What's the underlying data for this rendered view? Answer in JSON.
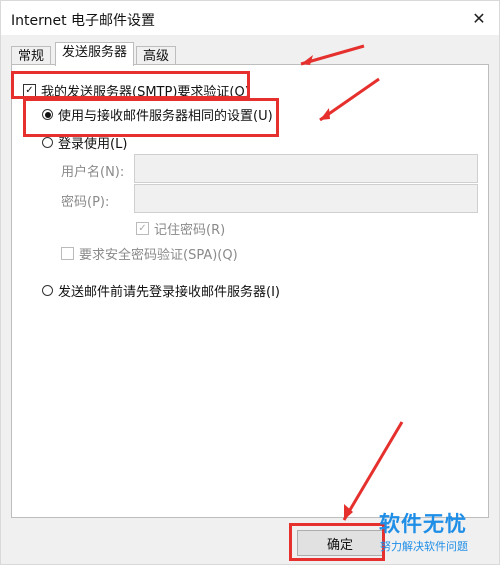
{
  "window": {
    "title": "Internet 电子邮件设置",
    "close_icon": "✕"
  },
  "tabs": [
    {
      "label": "常规",
      "active": false
    },
    {
      "label": "发送服务器",
      "active": true
    },
    {
      "label": "高级",
      "active": false
    }
  ],
  "smtp_auth": {
    "label": "我的发送服务器(SMTP)要求验证(O)",
    "checked": true
  },
  "radio_same": {
    "label": "使用与接收邮件服务器相同的设置(U)",
    "selected": true
  },
  "radio_login": {
    "label": "登录使用(L)",
    "selected": false
  },
  "username": {
    "label": "用户名(N):",
    "value": ""
  },
  "password": {
    "label": "密码(P):",
    "value": ""
  },
  "remember": {
    "label": "记住密码(R)",
    "checked": true
  },
  "spa": {
    "label": "要求安全密码验证(SPA)(Q)",
    "checked": false
  },
  "radio_prelogin": {
    "label": "发送邮件前请先登录接收邮件服务器(I)",
    "selected": false
  },
  "ok_button": {
    "label": "确定"
  },
  "watermark": {
    "title": "软件无忧",
    "subtitle": "努力解决软件问题"
  },
  "colors": {
    "annotation_red": "#e5302d",
    "watermark_blue": "#1e8ee7"
  }
}
